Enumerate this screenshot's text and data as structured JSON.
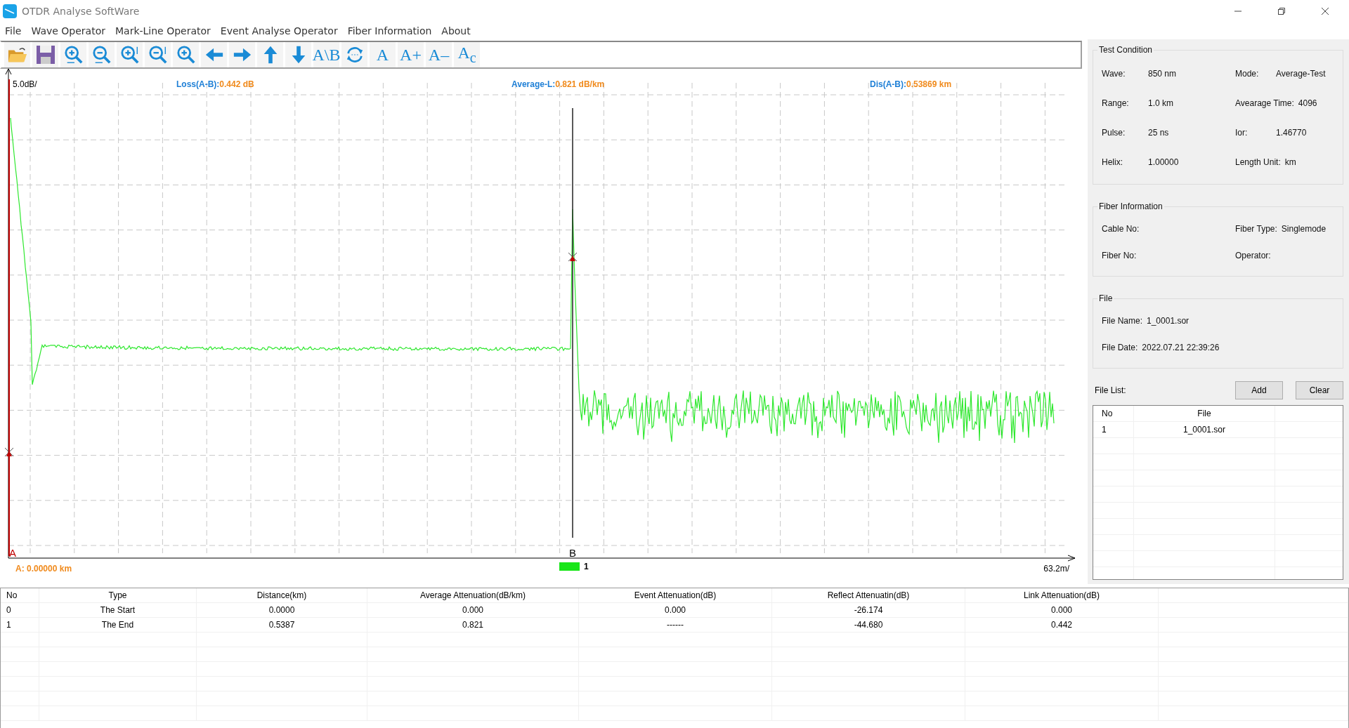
{
  "window": {
    "title": "OTDR Analyse SoftWare"
  },
  "menu": [
    "File",
    "Wave Operator",
    "Mark-Line Operator",
    "Event Analyse Operator",
    "Fiber Information",
    "About"
  ],
  "toolbar": [
    {
      "kind": "open"
    },
    {
      "kind": "save"
    },
    {
      "kind": "zoom-h-in"
    },
    {
      "kind": "zoom-h-out"
    },
    {
      "kind": "zoom-v-in"
    },
    {
      "kind": "zoom-v-out"
    },
    {
      "kind": "zoom"
    },
    {
      "kind": "left"
    },
    {
      "kind": "right"
    },
    {
      "kind": "up"
    },
    {
      "kind": "down"
    },
    {
      "kind": "text",
      "label": "A\\B"
    },
    {
      "kind": "refresh"
    },
    {
      "kind": "text",
      "label": "A"
    },
    {
      "kind": "text",
      "label": "A+"
    },
    {
      "kind": "text",
      "label": "A–"
    },
    {
      "kind": "text",
      "label": "A$_{c}$"
    }
  ],
  "chart": {
    "y_scale": "5.0dB/",
    "readouts": [
      {
        "label": "Loss(A-B):",
        "value": "0.442 dB"
      },
      {
        "label": "Average-L:",
        "value": "0.821 dB/km"
      },
      {
        "label": "Dis(A-B):",
        "value": "0.53869 km"
      }
    ],
    "markers": [
      "A",
      "B"
    ],
    "cursor_readout": "A: 0.00000 km",
    "legend": "1",
    "x_scale": "63.2m/"
  },
  "test_condition": {
    "title": "Test Condition",
    "fields": [
      {
        "label": "Wave:",
        "value": "850 nm"
      },
      {
        "label": "Mode:",
        "value": "Average-Test"
      },
      {
        "label": "Range:",
        "value": "1.0 km"
      },
      {
        "label": "Avearage Time:",
        "value": "4096"
      },
      {
        "label": "Pulse:",
        "value": "25 ns"
      },
      {
        "label": "Ior:",
        "value": "1.46770"
      },
      {
        "label": "Helix:",
        "value": "1.00000"
      },
      {
        "label": "Length Unit:",
        "value": "km"
      }
    ]
  },
  "fiber_information": {
    "title": "Fiber Information",
    "fields": [
      {
        "label": "Cable No:"
      },
      {
        "label": "Fiber Type:",
        "value": "Singlemode"
      },
      {
        "label": "Fiber No:"
      },
      {
        "label": "Operator:"
      }
    ]
  },
  "file": {
    "title": "File",
    "fields": [
      {
        "label": "File Name:",
        "value": "1_0001.sor"
      },
      {
        "label": "File Date:",
        "value": "2022.07.21  22:39:26"
      }
    ]
  },
  "file_list": {
    "label": "File List:",
    "buttons": [
      "Add",
      "Clear"
    ],
    "columns": [
      "No",
      "File"
    ],
    "rows": [
      [
        "1",
        "1_0001.sor"
      ]
    ]
  },
  "events": {
    "columns": [
      "No",
      "Type",
      "Distance(km)",
      "Average Attenuation(dB/km)",
      "Event Attenuation(dB)",
      "Reflect Attenuatin(dB)",
      "Link Attenuation(dB)"
    ],
    "rows": [
      [
        "0",
        "The Start",
        "0.0000",
        "0.000",
        "0.000",
        "-26.174",
        "0.000"
      ],
      [
        "1",
        "The End",
        "0.5387",
        "0.821",
        "------",
        "-44.680",
        "0.442"
      ]
    ]
  }
}
